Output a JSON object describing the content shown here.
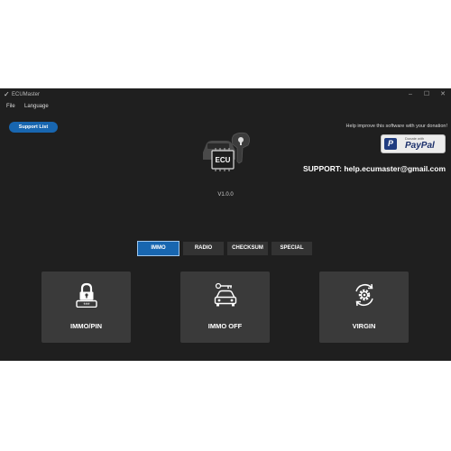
{
  "window": {
    "title": "ECUMaster",
    "app_icon": "wrench-icon",
    "controls": {
      "minimize": "–",
      "maximize": "☐",
      "close": "✕"
    }
  },
  "menu": {
    "file": "File",
    "language": "Language"
  },
  "support_list_label": "Support List",
  "donation": {
    "text": "Help improve this software with your donation!",
    "paypal_small": "Donate with",
    "paypal_logo": "PayPal",
    "paypal_letter": "P"
  },
  "support_email": "SUPPORT: help.ecumaster@gmail.com",
  "logo": {
    "chip_text": "ECU"
  },
  "version": "V1.0.0",
  "tabs": [
    {
      "label": "IMMO",
      "active": true
    },
    {
      "label": "RADIO",
      "active": false
    },
    {
      "label": "CHECKSUM",
      "active": false
    },
    {
      "label": "SPECIAL",
      "active": false
    }
  ],
  "cards": [
    {
      "label": "IMMO/PIN",
      "icon": "lock-pin-icon"
    },
    {
      "label": "IMMO OFF",
      "icon": "car-key-icon"
    },
    {
      "label": "VIRGIN",
      "icon": "gear-refresh-icon"
    }
  ],
  "colors": {
    "accent": "#1866b0",
    "background": "#1f1f1f",
    "card": "#3a3a3a"
  }
}
